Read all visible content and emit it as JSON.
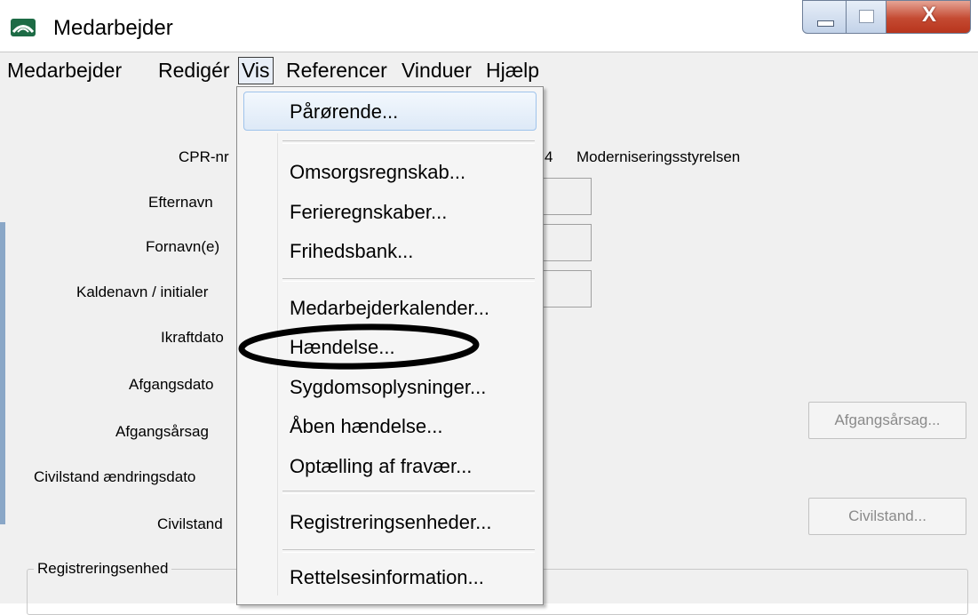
{
  "window": {
    "title": "Medarbejder",
    "controls": {
      "minimize": "minimize-icon",
      "maximize": "maximize-icon",
      "close": "close-icon"
    },
    "close_glyph": "X"
  },
  "menubar": {
    "items": [
      {
        "label": "Medarbejder"
      },
      {
        "label": "Redigér"
      },
      {
        "label": "Vis"
      },
      {
        "label": "Referencer"
      },
      {
        "label": "Vinduer"
      },
      {
        "label": "Hjælp"
      }
    ]
  },
  "form": {
    "labels": {
      "cpr": "CPR-nr",
      "efternavn": "Efternavn",
      "fornavn": "Fornavn(e)",
      "kaldenavn": "Kaldenavn / initialer",
      "ikraft": "Ikraftdato",
      "afgangsdato": "Afgangsdato",
      "afgangsaarsag": "Afgangsårsag",
      "civilstand_dato": "Civilstand ændringsdato",
      "civilstand": "Civilstand"
    },
    "cpr_suffix": "4",
    "institution": "Moderniseringsstyrelsen",
    "buttons": {
      "afgangsaarsag": "Afgangsårsag...",
      "civilstand": "Civilstand..."
    },
    "group_title": "Registreringsenhed"
  },
  "vis_menu": {
    "items": [
      {
        "label": "Pårørende..."
      },
      {
        "label": "Omsorgsregnskab..."
      },
      {
        "label": "Ferieregnskaber..."
      },
      {
        "label": "Frihedsbank..."
      },
      {
        "label": "Medarbejderkalender..."
      },
      {
        "label": "Hændelse..."
      },
      {
        "label": "Sygdomsoplysninger..."
      },
      {
        "label": "Åben hændelse..."
      },
      {
        "label": "Optælling af fravær..."
      },
      {
        "label": "Registreringsenheder..."
      },
      {
        "label": "Rettelsesinformation..."
      }
    ],
    "highlighted": "Pårørende...",
    "annotated": "Hændelse..."
  },
  "colors": {
    "menu_background": "#f5f5f5",
    "highlight_border": "#9fc3eb",
    "close_button": "#c44a32"
  }
}
